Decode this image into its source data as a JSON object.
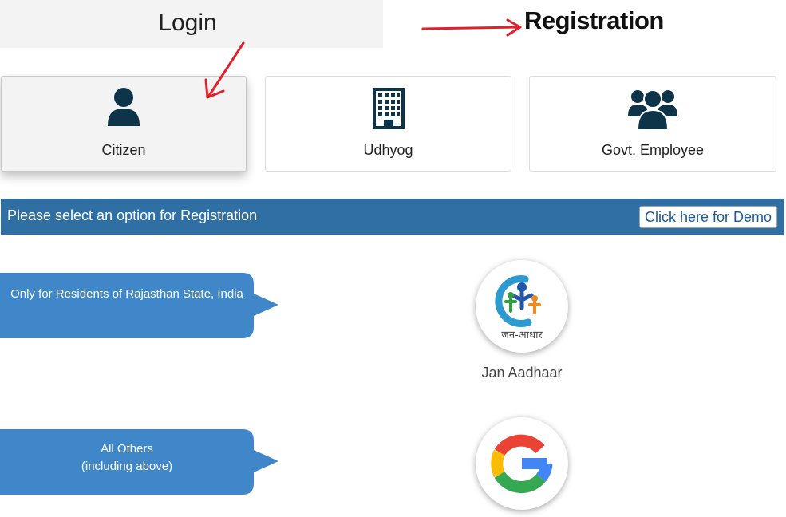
{
  "tabs": {
    "login": "Login",
    "registration": "Registration"
  },
  "user_types": [
    {
      "label": "Citizen",
      "icon": "user-icon"
    },
    {
      "label": "Udhyog",
      "icon": "building-icon"
    },
    {
      "label": "Govt. Employee",
      "icon": "users-icon"
    }
  ],
  "registration_bar": {
    "title": "Please select an option for Registration",
    "demo_button": "Click here for Demo"
  },
  "options": [
    {
      "note": "Only for Residents of Rajasthan State, India",
      "label": "Jan Aadhaar",
      "logo_text": "जन-आधार",
      "icon": "jan-aadhaar-logo"
    },
    {
      "note_line1": "All Others",
      "note_line2": "(including above)",
      "icon": "google-logo"
    }
  ],
  "colors": {
    "bar": "#2f6fa4",
    "bubble": "#3f87c8",
    "icon_dark": "#0d3448",
    "annotation_arrow": "#e0202a"
  }
}
